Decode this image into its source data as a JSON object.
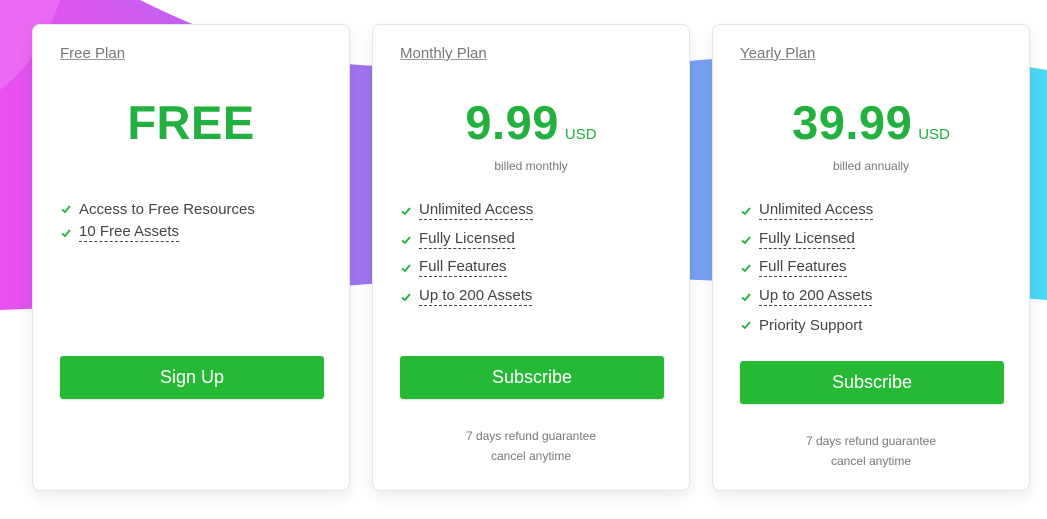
{
  "colors": {
    "accent": "#22b13f",
    "button": "#25b936",
    "text_muted": "#777777"
  },
  "icons": {
    "check": "check-icon"
  },
  "plans": [
    {
      "name": "Free Plan",
      "price": "FREE",
      "currency": "",
      "billing": "",
      "features": [
        {
          "label": "Access to Free Resources",
          "dotted": false
        },
        {
          "label": "10 Free Assets",
          "dotted": true
        }
      ],
      "button": "Sign Up",
      "refund_line1": "",
      "refund_line2": ""
    },
    {
      "name": "Monthly Plan",
      "price": "9.99",
      "currency": "USD",
      "billing": "billed monthly",
      "features": [
        {
          "label": "Unlimited Access",
          "dotted": true
        },
        {
          "label": "Fully Licensed",
          "dotted": true
        },
        {
          "label": "Full Features",
          "dotted": true
        },
        {
          "label": "Up to 200 Assets",
          "dotted": true
        }
      ],
      "button": "Subscribe",
      "refund_line1": "7 days refund guarantee",
      "refund_line2": "cancel anytime"
    },
    {
      "name": "Yearly Plan",
      "price": "39.99",
      "currency": "USD",
      "billing": "billed annually",
      "features": [
        {
          "label": "Unlimited Access",
          "dotted": true
        },
        {
          "label": "Fully Licensed",
          "dotted": true
        },
        {
          "label": "Full Features",
          "dotted": true
        },
        {
          "label": "Up to 200 Assets",
          "dotted": true
        },
        {
          "label": "Priority Support",
          "dotted": false
        }
      ],
      "button": "Subscribe",
      "refund_line1": "7 days refund guarantee",
      "refund_line2": "cancel anytime"
    }
  ]
}
